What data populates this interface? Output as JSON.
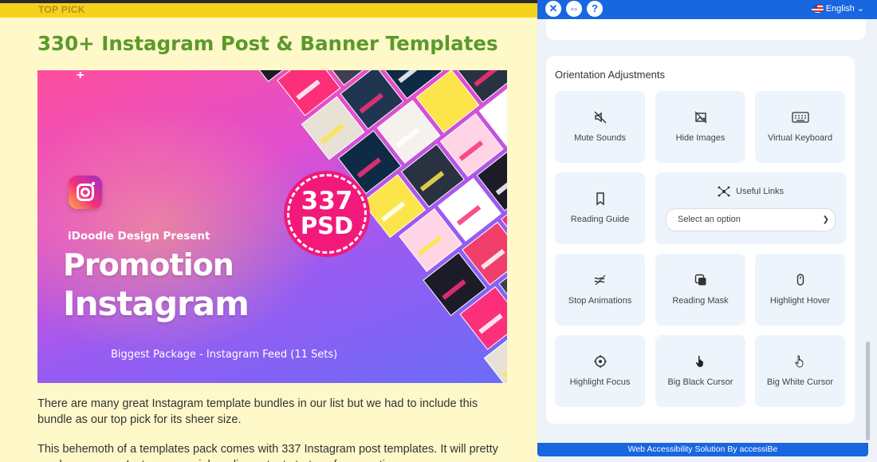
{
  "article": {
    "section_label": "TOP PICK",
    "title": "330+ Instagram Post & Banner Templates",
    "hero": {
      "presenter": "iDoodle Design Present",
      "headline_line1": "Promotion",
      "headline_line2": "Instagram",
      "package": "Biggest Package -  Instagram Feed (11 Sets)",
      "badge_number": "337",
      "badge_unit": "PSD",
      "logo_icon": "instagram-logo-icon",
      "colors": {
        "pink": "#ff4f9d",
        "violet": "#9a5bf2",
        "badge": "#f2197b"
      }
    },
    "paragraphs": [
      "There are many great Instagram template bundles in our list but we had to include this bundle as our top pick for its sheer size.",
      "This behemoth of a templates pack comes with 337 Instagram post templates. It will pretty much cover your Instagram social media content strategy for an entire year."
    ],
    "colors": {
      "title": "#5a9a2a",
      "background": "#fff8c9",
      "top_bar": "#f6d21c"
    }
  },
  "panel": {
    "header": {
      "close_icon": "close-icon",
      "move_icon": "resize-horizontal-icon",
      "help_icon": "help-icon",
      "language": "English",
      "flag_icon": "us-flag-icon"
    },
    "section_title": "Orientation Adjustments",
    "tiles": [
      {
        "label": "Mute Sounds",
        "icon": "mute-speaker-icon"
      },
      {
        "label": "Hide Images",
        "icon": "hide-image-icon"
      },
      {
        "label": "Virtual Keyboard",
        "icon": "keyboard-icon"
      },
      {
        "label": "Reading Guide",
        "icon": "bookmark-icon"
      },
      {
        "label": "Stop Animations",
        "icon": "waves-icon"
      },
      {
        "label": "Reading Mask",
        "icon": "mask-icon"
      },
      {
        "label": "Highlight Hover",
        "icon": "mouse-icon"
      },
      {
        "label": "Highlight Focus",
        "icon": "focus-target-icon"
      },
      {
        "label": "Big Black Cursor",
        "icon": "black-cursor-icon"
      },
      {
        "label": "Big White Cursor",
        "icon": "white-cursor-icon"
      }
    ],
    "useful_links": {
      "label": "Useful Links",
      "icon": "network-links-icon",
      "selected": "Select an option"
    },
    "footer": "Web Accessibility Solution By accessiBe",
    "colors": {
      "accent": "#1866e0",
      "tile": "#eef4fc",
      "panel_bg": "#eef2f9"
    }
  }
}
